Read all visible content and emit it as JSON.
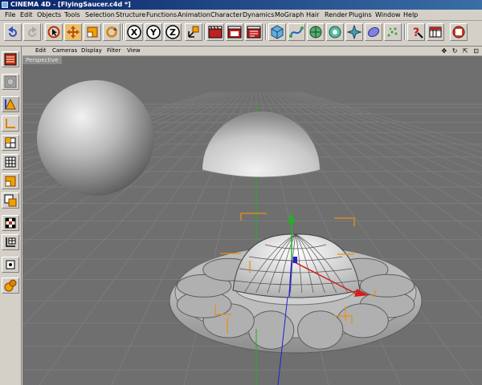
{
  "window": {
    "title": "CINEMA 4D - [FlyingSaucer.c4d *]"
  },
  "menu": [
    "File",
    "Edit",
    "Objects",
    "Tools",
    "Selection",
    "Structure",
    "Functions",
    "Animation",
    "Character",
    "Dynamics",
    "MoGraph",
    "Hair",
    "Render",
    "Plugins",
    "Window",
    "Help"
  ],
  "toolbar": {
    "axis_x": "X",
    "axis_y": "Y",
    "axis_z": "Z",
    "icons": [
      "undo-icon",
      "redo-icon",
      "live-selection-icon",
      "move-icon",
      "scale-icon",
      "rotate-icon",
      "x-axis-icon",
      "y-axis-icon",
      "z-axis-icon",
      "coordinate-system-icon",
      "render-view-icon",
      "render-picture-viewer-icon",
      "render-settings-icon",
      "cube-icon",
      "spline-icon",
      "nurbs-icon",
      "array-icon",
      "deformer-icon",
      "scene-icon",
      "light-icon",
      "help-icon",
      "layout-icon",
      "floor-icon"
    ]
  },
  "left_tools": [
    "use-model-mode-icon",
    "use-object-mode-icon",
    "use-points-mode-icon",
    "use-edges-mode-icon",
    "use-polygons-mode-icon",
    "texture-mode-icon",
    "object-axis-icon",
    "texture-axis-icon",
    "tweak-mode-icon",
    "workplane-icon",
    "inactive-icon",
    "sculpt-icon"
  ],
  "viewport_menu": [
    "Edit",
    "Cameras",
    "Display",
    "Filter",
    "View"
  ],
  "viewport": {
    "label": "Perspective",
    "nav_icons": "✥ ↻ ⇱ ⊡"
  },
  "colors": {
    "viewport_bg": "#6f6f6f",
    "grid": "#7c7c7c",
    "axis_green": "#22b022",
    "axis_red": "#d02020",
    "axis_blue": "#2020d0",
    "bbox_orange": "#e89018",
    "title_start": "#0a246a",
    "title_end": "#3a6ea5"
  }
}
